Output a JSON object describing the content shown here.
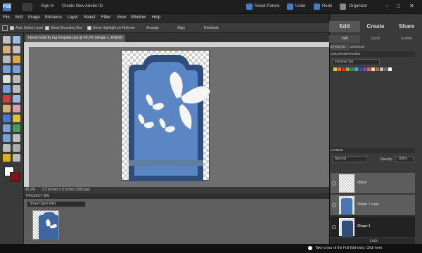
{
  "topbar": {
    "sign_in": "Sign In",
    "create_id": "Create New Adobe ID",
    "reset_panels": "Reset Panels",
    "undo": "Undo",
    "redo": "Redo",
    "organizer": "Organizer",
    "logo_text": "PSE"
  },
  "menu": [
    "File",
    "Edit",
    "Image",
    "Enhance",
    "Layer",
    "Select",
    "Filter",
    "View",
    "Window",
    "Help"
  ],
  "options": {
    "auto_select": "Auto Select Layer",
    "show_bbox": "Show Bounding Box",
    "show_highlight": "Show Highlight on Rollover",
    "arrange": "Arrange",
    "align": "Align",
    "distribute": "Distribute"
  },
  "document": {
    "tab_title": "hybrid butterfly tag template.psd @ 45.2% (Shape 1, RGB/8)",
    "zoom": "45.2%",
    "size_info": "2.5 inches x 5 inches (300 ppi)"
  },
  "project_bin": {
    "title": "PROJECT BIN",
    "selector": "Show Open Files"
  },
  "panel": {
    "modes": [
      "Edit",
      "Create",
      "Share"
    ],
    "submodes": [
      "Full",
      "Quick",
      "Guided"
    ],
    "effects_tab": "EFFECTS",
    "content_tab": "CONTENT",
    "color_swatches_title": "COLOR SWATCHES",
    "swatch_set": "summer fun",
    "swatches": [
      "#e8c23a",
      "#d97a2b",
      "#c83a2a",
      "#8fb44a",
      "#3a8a4a",
      "#5aa0d0",
      "#2a5a9a",
      "#7a4a9a",
      "#d05a8a",
      "#f0e0a0",
      "#a07a4a",
      "#c0c0c0",
      "#6a6a6a",
      "#ffffff"
    ],
    "layers_title": "LAYERS",
    "blend_mode": "Normal",
    "opacity_label": "Opacity:",
    "opacity_value": "100%",
    "layers": [
      "ribbon",
      "Shape 1 copy",
      "Shape 1"
    ],
    "lock_label": "Lock:"
  },
  "hint": "Take a tour of the Full Edit tools. Click here."
}
